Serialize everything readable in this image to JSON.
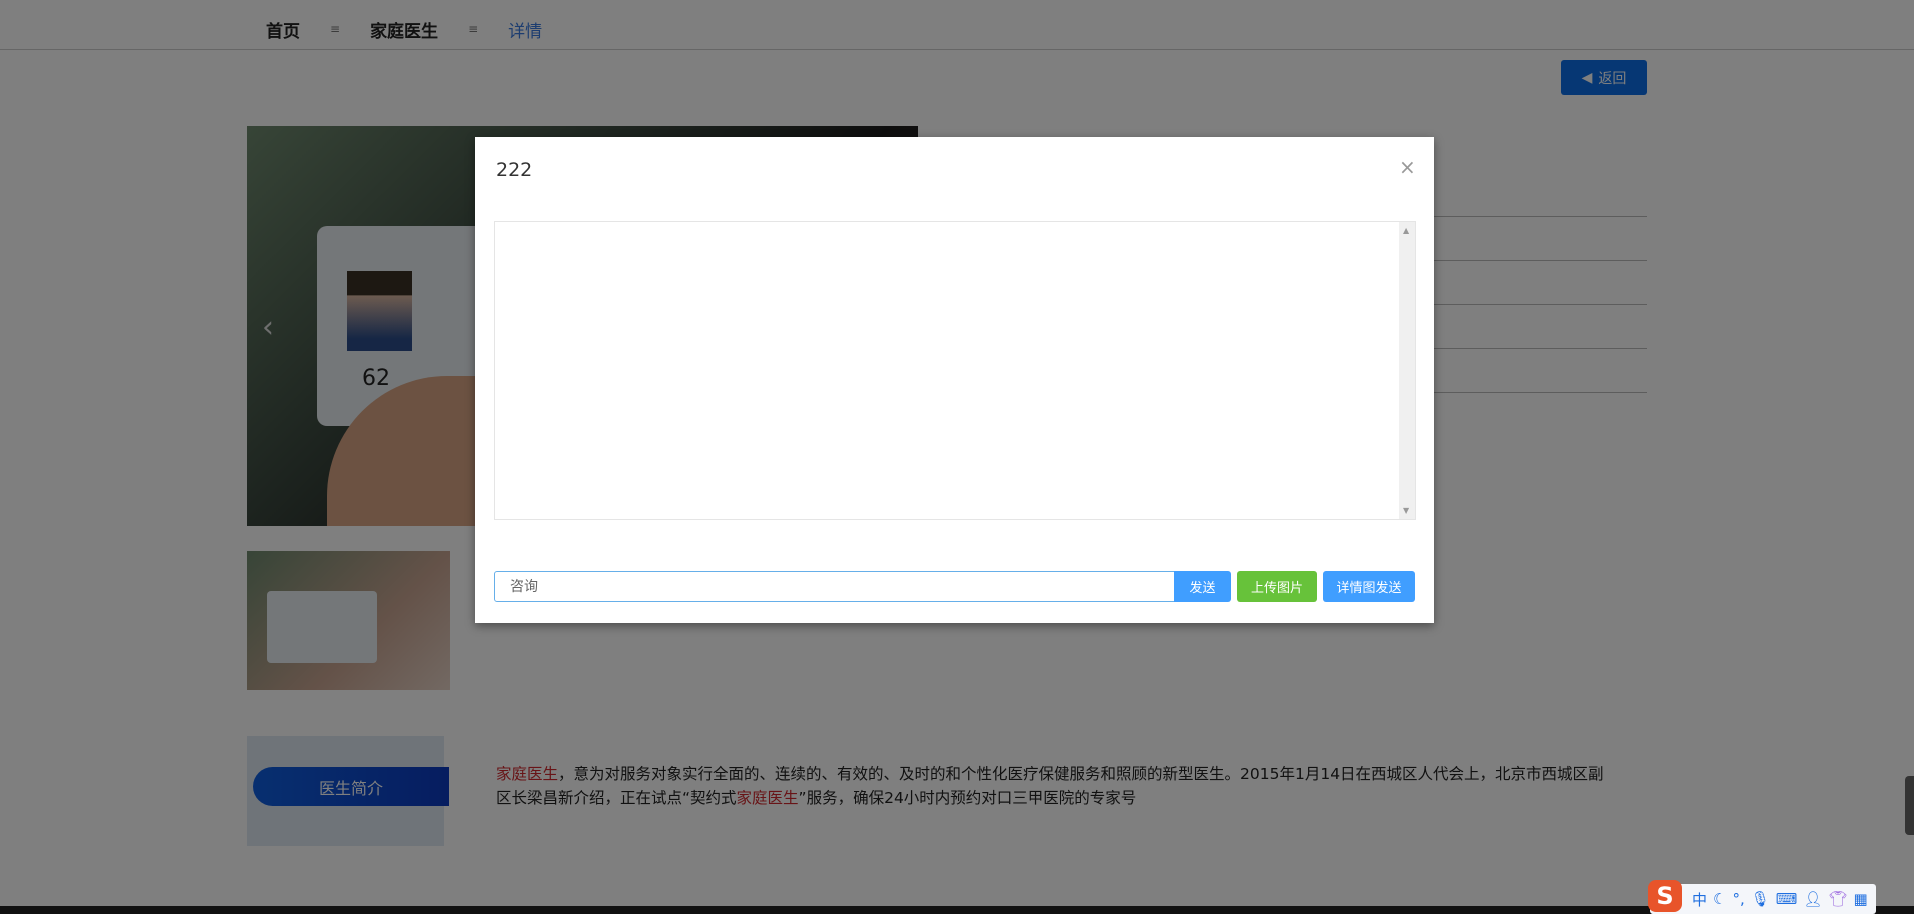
{
  "nav": {
    "home": "首页",
    "family_doctor": "家庭医生",
    "detail": "详情",
    "separator": "≡"
  },
  "back_button": {
    "icon": "caret-left-icon",
    "label": "返回"
  },
  "intro": {
    "tab_label": "医生简介",
    "paragraph": [
      {
        "text": "家庭医生",
        "highlight": true
      },
      {
        "text": "，意为对服务对象实行全面的、连续的、有效的、及时的和个性化医疗保健服务和照顾的新型医生。2015年1月14日在西城区人代会上，北京市西城区副区长梁昌新介绍，正在试点“契约式",
        "highlight": false
      },
      {
        "text": "家庭医生",
        "highlight": true
      },
      {
        "text": "”服务，确保24小时内预约对口三甲医院的专家号",
        "highlight": false
      }
    ]
  },
  "image": {
    "card_number_visible": "62"
  },
  "modal": {
    "title": "222",
    "close": "×",
    "input_placeholder": "咨询",
    "input_value": "",
    "buttons": {
      "send": "发送",
      "upload": "上传图片",
      "detail_send": "详情图发送"
    }
  },
  "ime": {
    "mode": "中",
    "logo": "S"
  },
  "colors": {
    "accent": "#409eff",
    "success": "#67c23a",
    "highlight": "#d0282e",
    "back": "#0c6fe8"
  }
}
